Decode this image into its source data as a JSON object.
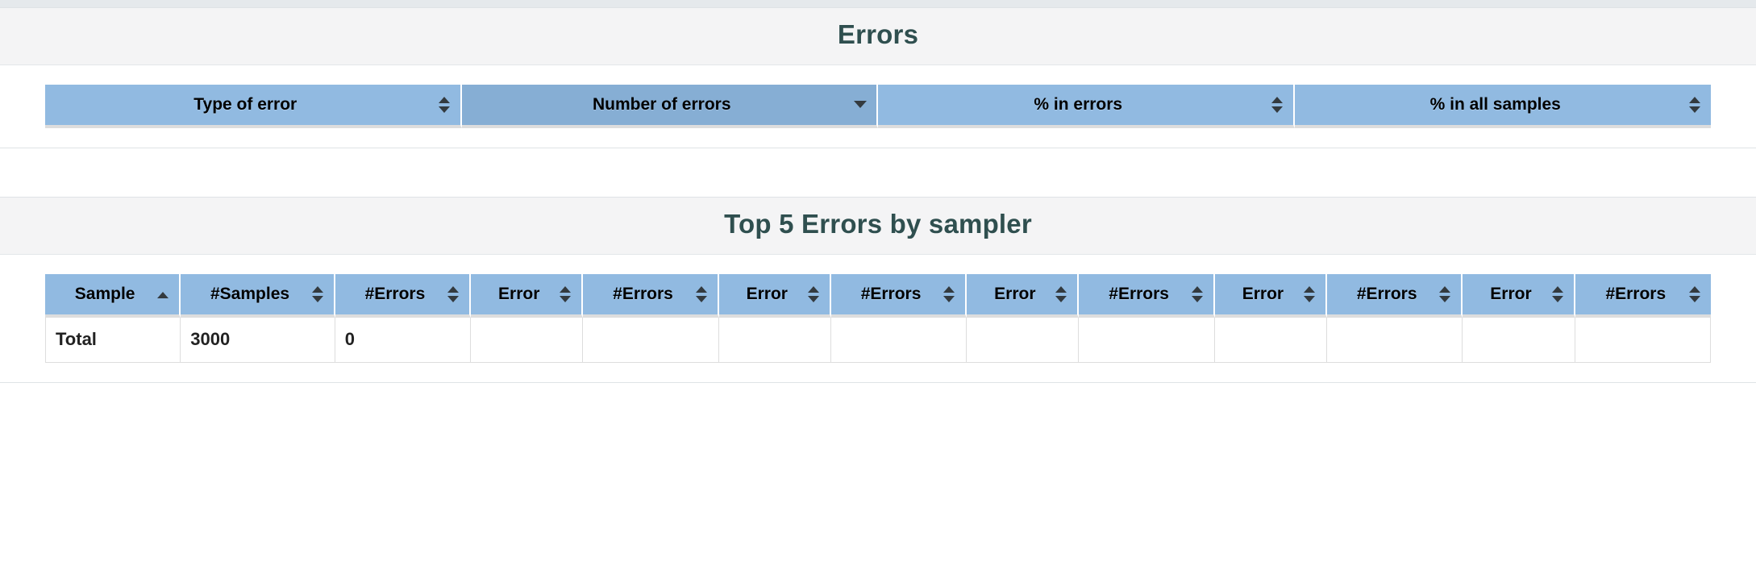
{
  "page": {
    "background": "#ffffff",
    "accent_header_bg": "#91bae1",
    "accent_header_bg_active": "#86aed4",
    "title_color": "#2f4f4f",
    "grid_border": "#dddddd"
  },
  "panels": [
    {
      "id": "errors-panel",
      "title": "Errors",
      "table": {
        "name": "errors-table",
        "columns": [
          {
            "label": "Type of error",
            "sort": "both",
            "active": false
          },
          {
            "label": "Number of errors",
            "sort": "desc",
            "active": true
          },
          {
            "label": "% in errors",
            "sort": "both",
            "active": false
          },
          {
            "label": "% in all samples",
            "sort": "both",
            "active": false
          }
        ],
        "rows": []
      }
    },
    {
      "id": "top5-errors-panel",
      "title": "Top 5 Errors by sampler",
      "table": {
        "name": "top5-errors-by-sampler-table",
        "columns": [
          {
            "label": "Sample",
            "sort": "asc",
            "active": false
          },
          {
            "label": "#Samples",
            "sort": "both",
            "active": false
          },
          {
            "label": "#Errors",
            "sort": "both",
            "active": false
          },
          {
            "label": "Error",
            "sort": "both",
            "active": false
          },
          {
            "label": "#Errors",
            "sort": "both",
            "active": false
          },
          {
            "label": "Error",
            "sort": "both",
            "active": false
          },
          {
            "label": "#Errors",
            "sort": "both",
            "active": false
          },
          {
            "label": "Error",
            "sort": "both",
            "active": false
          },
          {
            "label": "#Errors",
            "sort": "both",
            "active": false
          },
          {
            "label": "Error",
            "sort": "both",
            "active": false
          },
          {
            "label": "#Errors",
            "sort": "both",
            "active": false
          },
          {
            "label": "Error",
            "sort": "both",
            "active": false
          },
          {
            "label": "#Errors",
            "sort": "both",
            "active": false
          }
        ],
        "rows": [
          [
            "Total",
            "3000",
            "0",
            "",
            "",
            "",
            "",
            "",
            "",
            "",
            "",
            "",
            ""
          ]
        ]
      }
    }
  ],
  "icons": {
    "sort_both": "sort-both-icon",
    "sort_asc": "sort-asc-icon",
    "sort_desc": "sort-desc-icon"
  }
}
